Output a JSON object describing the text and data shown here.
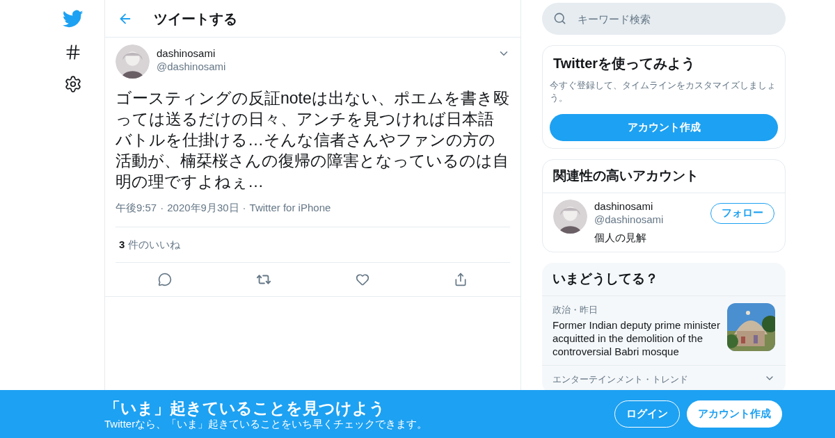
{
  "header": {
    "title": "ツイートする"
  },
  "tweet": {
    "name": "dashinosami",
    "handle": "@dashinosami",
    "text": "ゴースティングの反証noteは出ない、ポエムを書き殴っては送るだけの日々、アンチを見つければ日本語バトルを仕掛ける…そんな信者さんやファンの方の活動が、楠栞桜さんの復帰の障害となっているのは自明の理ですよねぇ…",
    "time": "午後9:57",
    "separator_1": "·",
    "date": "2020年9月30日",
    "separator_2": "·",
    "source": "Twitter for iPhone",
    "like_count": "3",
    "like_label": "件のいいね"
  },
  "search": {
    "placeholder": "キーワード検索"
  },
  "signup_card": {
    "title": "Twitterを使ってみよう",
    "text": "今すぐ登録して、タイムラインをカスタマイズしましょう。",
    "button": "アカウント作成"
  },
  "related": {
    "title": "関連性の高いアカウント",
    "accounts": [
      {
        "name": "dashinosami",
        "handle": "@dashinosami",
        "bio": "個人の見解",
        "button": "フォロー"
      }
    ]
  },
  "trends": {
    "title": "いまどうしてる？",
    "items": [
      {
        "kind": "news",
        "meta": "政治・昨日",
        "text": "Former Indian deputy prime minister acquitted in the demolition of the controversial Babri mosque"
      },
      {
        "kind": "trend",
        "meta": "エンターテインメント・トレンド"
      }
    ]
  },
  "banner": {
    "title": "「いま」起きていることを見つけよう",
    "subtitle": "Twitterなら、「いま」起きていることをいち早くチェックできます。",
    "login": "ログイン",
    "signup": "アカウント作成"
  }
}
